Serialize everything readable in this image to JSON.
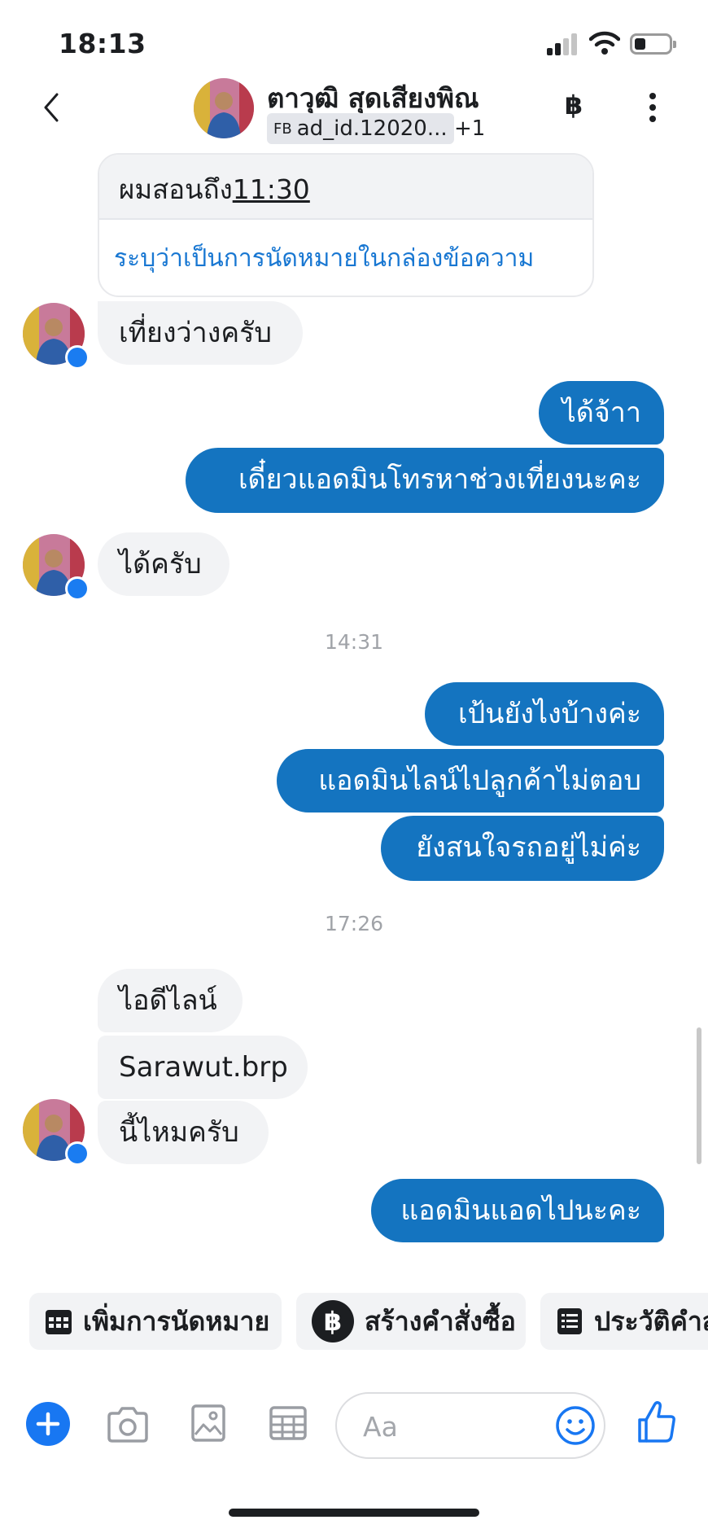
{
  "status_bar": {
    "time": "18:13"
  },
  "header": {
    "contact_name": "ตาวุฒิ สุดเสียงพิณ",
    "tag_prefix": "FB",
    "tag_text": "ad_id.12020...",
    "extra_count": "+1",
    "currency_symbol": "฿"
  },
  "appointment_card": {
    "text": "ผมสอนถึง",
    "time": "11:30",
    "link": "ระบุว่าเป็นการนัดหมายในกล่องข้อความ"
  },
  "messages": {
    "m1": "เที่ยงว่างครับ",
    "m2": "ได้จ้าา",
    "m3": "เดี๋ยวแอดมินโทรหาช่วงเที่ยงนะคะ",
    "m4": "ได้ครับ",
    "ts1": "14:31",
    "m5": "เป้นยังไงบ้างค่ะ",
    "m6": "แอดมินไลน์ไปลูกค้าไม่ตอบ",
    "m7": "ยังสนใจรถอยู่ไม่ค่ะ",
    "ts2": "17:26",
    "m8": "ไอดีไลน์",
    "m9": "Sarawut.brp",
    "m10": "นี้ไหมครับ",
    "m11": "แอดมินแอดไปนะคะ"
  },
  "quick_actions": [
    {
      "label": "เพิ่มการนัดหมาย",
      "icon": "calendar-icon"
    },
    {
      "label": "สร้างคำสั่งซื้อ",
      "icon": "baht-icon"
    },
    {
      "label": "ประวัติคำสั่งซื้อ",
      "icon": "receipt-icon"
    }
  ],
  "composer": {
    "placeholder": "Aa"
  },
  "colors": {
    "outgoing_bubble": "#1474c0",
    "incoming_bubble": "#f2f3f5",
    "link": "#1877d2",
    "accent": "#1877f2"
  }
}
